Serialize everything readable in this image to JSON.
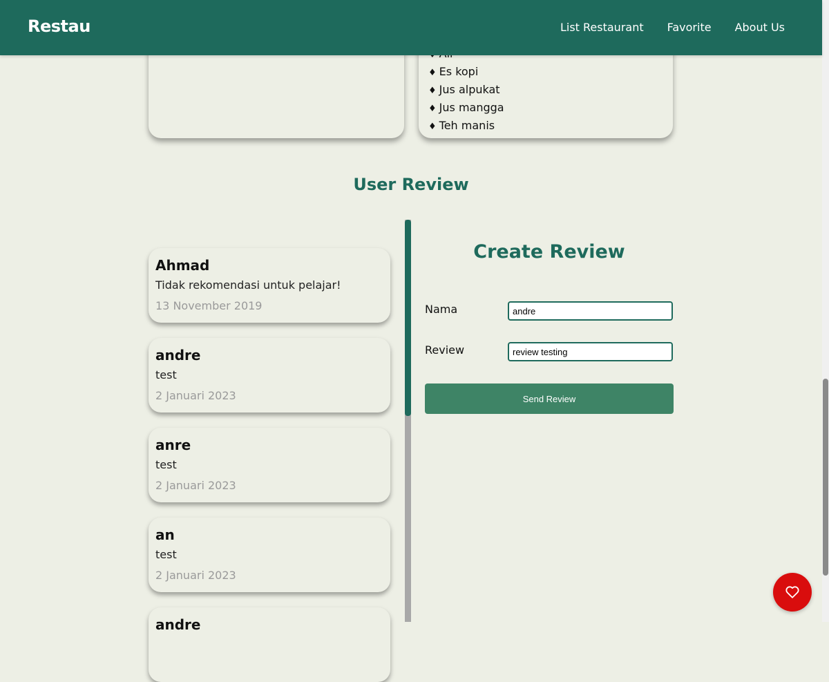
{
  "header": {
    "brand": "Restau",
    "nav": [
      "List Restaurant",
      "Favorite",
      "About Us"
    ]
  },
  "menu": {
    "drinks": [
      "Air",
      "Es kopi",
      "Jus alpukat",
      "Jus mangga",
      "Teh manis"
    ]
  },
  "reviews_section": {
    "title": "User Review",
    "reviews": [
      {
        "name": "Ahmad",
        "text": "Tidak rekomendasi untuk pelajar!",
        "date": "13 November 2019"
      },
      {
        "name": "andre",
        "text": "test",
        "date": "2 Januari 2023"
      },
      {
        "name": "anre",
        "text": "test",
        "date": "2 Januari 2023"
      },
      {
        "name": "an",
        "text": "test",
        "date": "2 Januari 2023"
      },
      {
        "name": "andre",
        "text": "",
        "date": ""
      }
    ]
  },
  "form": {
    "title": "Create Review",
    "name_label": "Nama",
    "name_value": "andre",
    "review_label": "Review",
    "review_value": "review testing",
    "submit_label": "Send Review"
  },
  "fab": {
    "icon": "heart-outline-icon"
  },
  "colors": {
    "primary": "#1e6a5c",
    "button": "#3e8466",
    "background": "#edefe5",
    "favorite": "#d90d0d"
  }
}
